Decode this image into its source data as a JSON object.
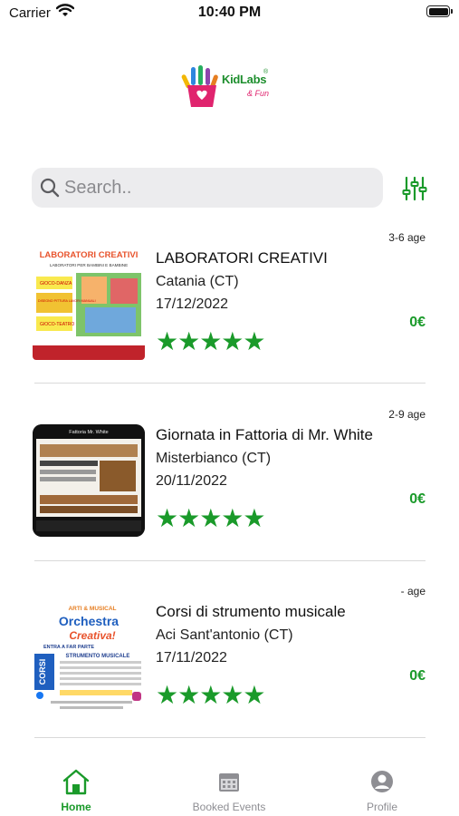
{
  "status_bar": {
    "carrier": "Carrier",
    "time": "10:40 PM"
  },
  "brand": {
    "name": "KidLabs",
    "tagline": "& Fun",
    "registered": "®"
  },
  "search": {
    "placeholder": "Search.."
  },
  "events": [
    {
      "title": "LABORATORI CREATIVI",
      "city": "Catania (CT)",
      "date": "17/12/2022",
      "age": "3-6 age",
      "price": "0€",
      "rating_stars": "★★★★★",
      "rating": 5,
      "poster": {
        "heading": "LABORATORI CREATIVI",
        "sub": "LABORATORI PER BAMBINI E BAMBINE",
        "tags": [
          "GIOCO-DANZA",
          "DISEGNO PITTURA LAVORI MANUALI",
          "GIOCO-TEATRO"
        ]
      }
    },
    {
      "title": "Giornata in Fattoria di Mr. White",
      "city": "Misterbianco (CT)",
      "date": "20/11/2022",
      "age": "2-9 age",
      "price": "0€",
      "rating_stars": "★★★★★",
      "rating": 5,
      "poster": {
        "heading": "Fattoria Mr. White"
      }
    },
    {
      "title": "Corsi di strumento musicale",
      "city": "Aci Sant'antonio (CT)",
      "date": "17/11/2022",
      "age": "- age",
      "price": "0€",
      "rating_stars": "★★★★★",
      "rating": 5,
      "poster": {
        "brand": "ARTI & MUSICAL",
        "heading1": "Orchestra",
        "heading2": "Creativa!",
        "line": "ENTRA A FAR PARTE",
        "section": "STRUMENTO MUSICALE",
        "side": "CORSI"
      }
    }
  ],
  "tabs": [
    {
      "label": "Home",
      "icon": "home-icon",
      "active": true
    },
    {
      "label": "Booked Events",
      "icon": "calendar-icon",
      "active": false
    },
    {
      "label": "Profile",
      "icon": "profile-icon",
      "active": false
    }
  ],
  "colors": {
    "accent": "#1a9a2a",
    "search_bg": "#ececee",
    "brand_pink": "#e0246e"
  }
}
